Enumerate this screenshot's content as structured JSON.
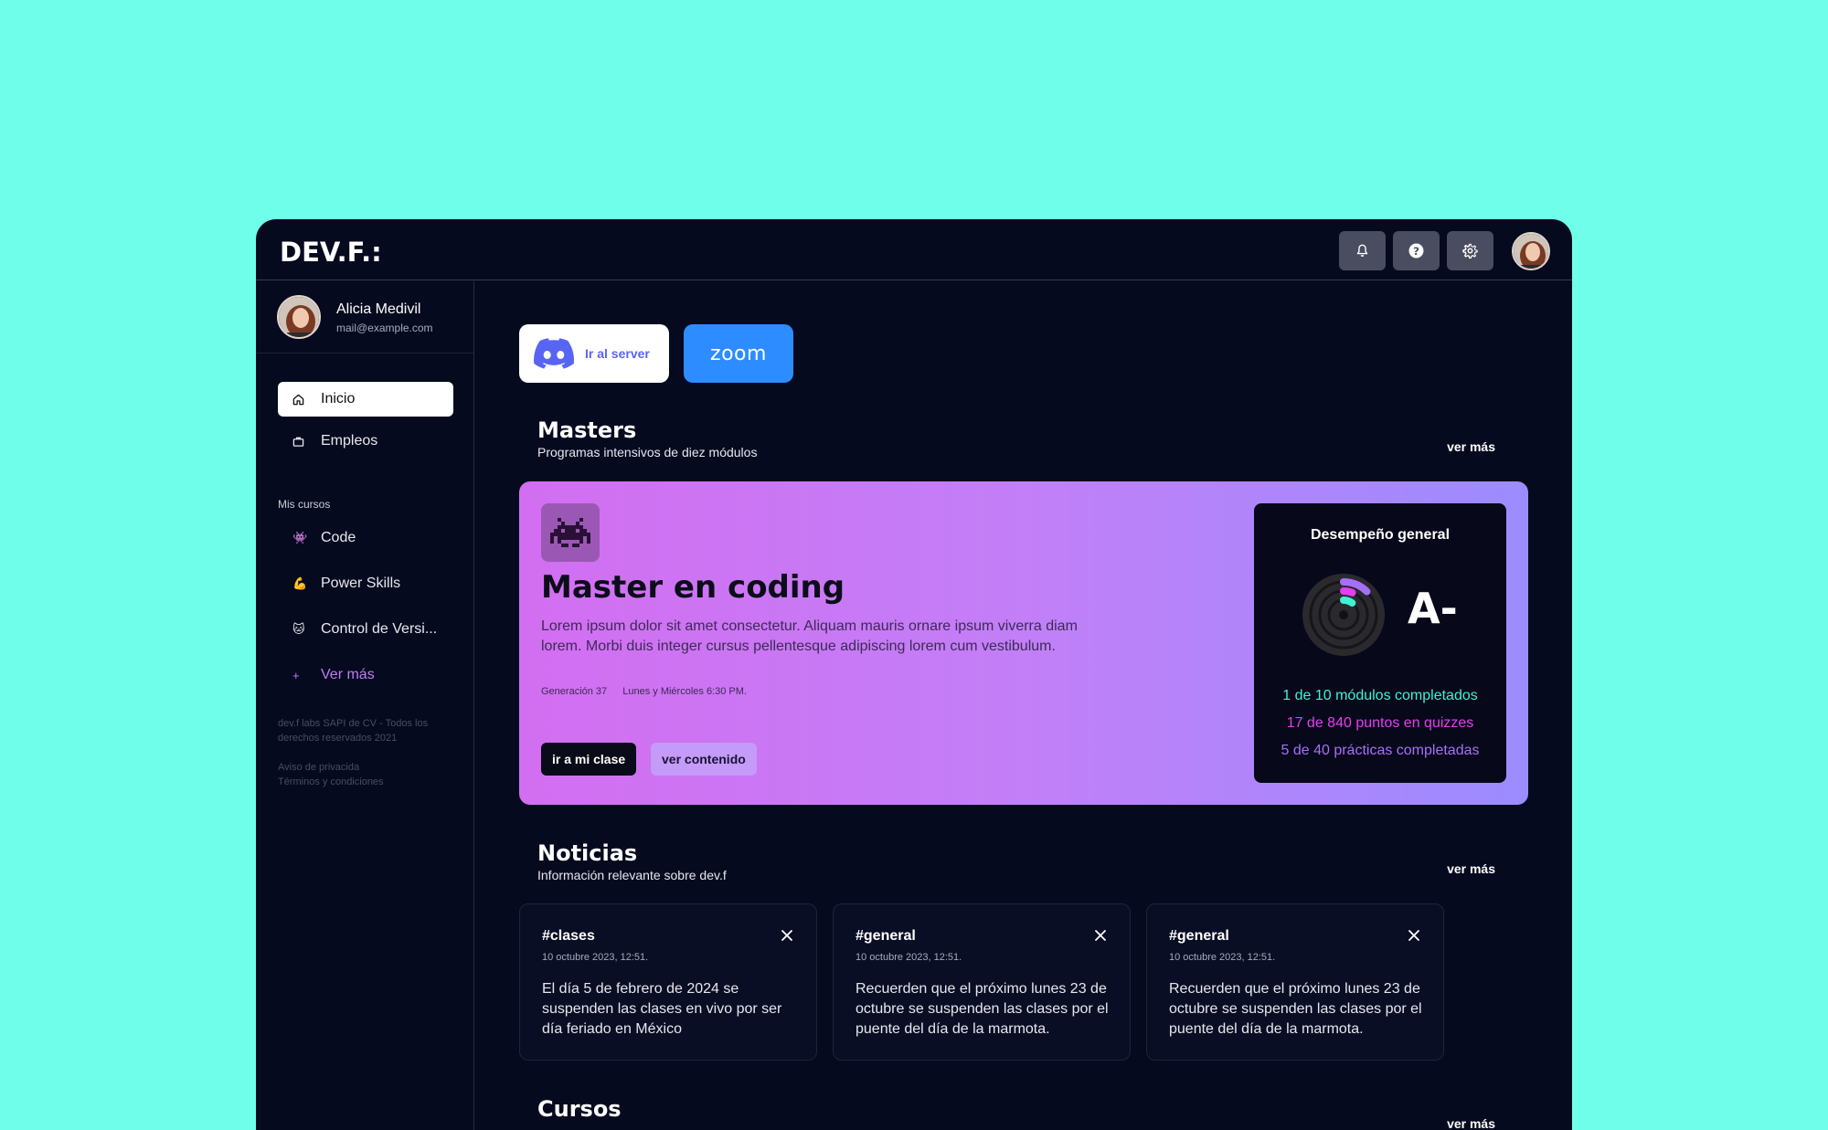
{
  "header": {
    "logo": "DEV.F.:",
    "actions": [
      {
        "icon": "bell-icon"
      },
      {
        "icon": "help-icon"
      },
      {
        "icon": "gear-icon"
      }
    ]
  },
  "sidebar": {
    "profile": {
      "name": "Alicia Medivil",
      "email": "mail@example.com"
    },
    "nav": [
      {
        "label": "Inicio",
        "icon": "home-icon",
        "active": true
      },
      {
        "label": "Empleos",
        "icon": "briefcase-icon",
        "active": false
      }
    ],
    "courses_label": "Mis cursos",
    "courses": [
      {
        "label": "Code",
        "icon": "👾"
      },
      {
        "label": "Power Skills",
        "icon": "💪"
      },
      {
        "label": "Control de Versi...",
        "icon": "🐱"
      }
    ],
    "more": {
      "icon": "+",
      "label": "Ver más"
    },
    "legal": {
      "copyright": "dev.f labs SAPI de CV - Todos los derechos reservados 2021",
      "privacy": "Aviso de privacida",
      "terms": "Términos y condiciones"
    }
  },
  "quick_links": {
    "discord_label": "Ir al server",
    "zoom_label": "zoom"
  },
  "masters": {
    "title": "Masters",
    "subtitle": "Programas intensivos de diez módulos",
    "ver_mas": "ver más",
    "card": {
      "icon": "👾",
      "title": "Master en coding",
      "description": "Lorem ipsum dolor sit amet consectetur. Aliquam mauris ornare ipsum viverra diam lorem. Morbi duis integer cursus pellentesque adipiscing lorem cum vestibulum.",
      "generation": "Generación 37",
      "schedule": "Lunes y Miércoles 6:30 PM.",
      "primary_button": "ir a mi clase",
      "secondary_button": "ver contenido"
    },
    "performance": {
      "title": "Desempeño general",
      "grade": "A-",
      "stats": [
        {
          "text": "1 de 10 módulos completados",
          "color": "#3ef2d2"
        },
        {
          "text": "17 de 840 puntos en quizzes",
          "color": "#e43ff0"
        },
        {
          "text": "5 de 40 prácticas completadas",
          "color": "#a76ff5"
        }
      ],
      "progress": {
        "modules": 0.1,
        "quizzes": 0.02,
        "practices": 0.125
      }
    }
  },
  "news": {
    "title": "Noticias",
    "subtitle": "Información relevante sobre dev.f",
    "ver_mas": "ver más",
    "items": [
      {
        "tag": "#clases",
        "date": "10 octubre 2023, 12:51.",
        "body": "El día 5 de febrero de 2024 se suspenden las clases en vivo por ser día feriado en México"
      },
      {
        "tag": "#general",
        "date": "10 octubre 2023, 12:51.",
        "body": "Recuerden que el próximo lunes 23 de octubre se suspenden las clases por el puente del día de la marmota."
      },
      {
        "tag": "#general",
        "date": "10 octubre 2023, 12:51.",
        "body": "Recuerden que el próximo lunes 23 de octubre se suspenden las clases por el puente del día de la marmota."
      }
    ]
  },
  "cursos": {
    "title": "Cursos",
    "ver_mas": "ver más"
  }
}
